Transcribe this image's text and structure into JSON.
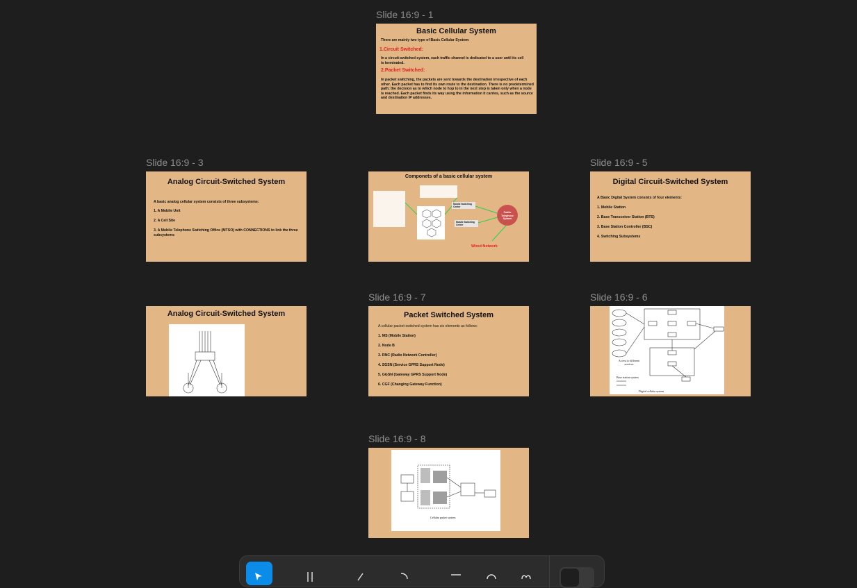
{
  "labels": {
    "s1": "Slide 16:9 - 1",
    "s3": "Slide 16:9 - 3",
    "s5": "Slide 16:9 - 5",
    "s7": "Slide 16:9 - 7",
    "s6": "Slide 16:9 - 6",
    "s8": "Slide 16:9 - 8"
  },
  "slide1": {
    "title": "Basic Cellular System",
    "intro": "There are mainly two type of Basic Cellular System:",
    "h1": "1.Circuit Switched:",
    "p1": "In a circuit-switched system, each traffic channel is dedicated to a user until its cell is terminated.",
    "h2": "2.Packet Switched:",
    "p2": "In packet switching, the packets are sent towards the destination irrespective of each other. Each packet has to find its own route to the destination. There is no predetermined path; the decision as to which node to hop to in the next step is taken only when a node is reached. Each packet finds its way using the information it carries, such as the source and destination IP addresses."
  },
  "slide3": {
    "title": "Analog Circuit-Switched System",
    "intro": "A basic analog cellular system consists of three subsystems:",
    "item1": "1. A Mobile Unit",
    "item2": "2. A Cell Site",
    "item3": "3. A Mobile Telephone Switching Office (MTSO) with CONNECTIONS to link the three subsystems"
  },
  "slide_components": {
    "title": "Componets of a basic cellular system",
    "public_net": "Public Telephone System",
    "wired": "Wired Network",
    "box_mobile": "Mobile Switching Center",
    "box_mobile2": "Mobile Switching Center"
  },
  "slide5": {
    "title": "Digital Circuit-Switched System",
    "intro": "A Basic Digital System consists of four elements:",
    "item1": "1. Mobile Station",
    "item2": "2. Base Transceiver Station (BTS)",
    "item3": "3. Base Station Controller (BSC)",
    "item4": "4. Switching Subsystems"
  },
  "slide_analog2": {
    "title": "Analog Circuit-Switched System"
  },
  "slide7": {
    "title": "Packet Switched System",
    "intro": "A cellular packet-switched system has six elements as follows:",
    "item1": "1. MS (Mobile Station)",
    "item2": "2. Node B",
    "item3": "3. RNC (Radio Network Controller)",
    "item4": "4. SGSN (Service GPRS Support Node)",
    "item5": "5. GGSN (Gateway GPRS Support Node)",
    "item6": "6. CGF (Changing Gateway Function)"
  },
  "slide6": {
    "caption": "Digital cellular system",
    "access": "Access to different services",
    "bss_label": "Base station system"
  },
  "slide8": {
    "caption": "Cellular packet system"
  },
  "colors": {
    "canvas": "#1e1e1e",
    "slide_bg": "#e3b785",
    "accent_red": "#e21d1d",
    "toolbar_active": "#0c8ce9"
  },
  "toolbar": {
    "tools": [
      "move-icon",
      "frame-icon",
      "pen-icon",
      "comment-icon",
      "rectangle-icon",
      "shape-icon",
      "code-icon"
    ]
  }
}
